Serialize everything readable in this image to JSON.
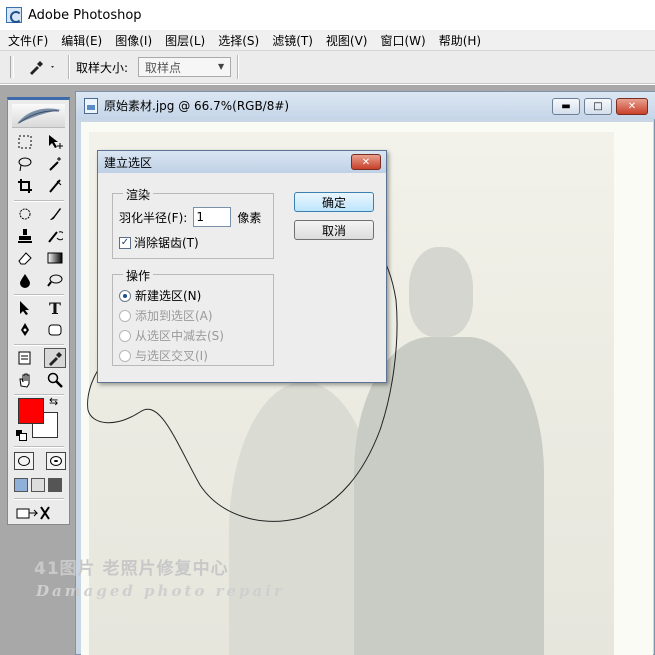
{
  "app": {
    "title": "Adobe Photoshop"
  },
  "menu": {
    "items": [
      "文件(F)",
      "编辑(E)",
      "图像(I)",
      "图层(L)",
      "选择(S)",
      "滤镜(T)",
      "视图(V)",
      "窗口(W)",
      "帮助(H)"
    ]
  },
  "options": {
    "tool_icon": "eyedropper-icon",
    "sample_size_label": "取样大小:",
    "sample_size_value": "取样点"
  },
  "document": {
    "title": "原始素材.jpg @ 66.7%(RGB/8#)",
    "minimize": "▬",
    "restore": "□",
    "close": "✕"
  },
  "watermark": {
    "line1": "41图片 老照片修复中心",
    "line2": "Damaged photo repair"
  },
  "dialog": {
    "title": "建立选区",
    "close": "✕",
    "render_group": "渲染",
    "feather_label": "羽化半径(F):",
    "feather_value": "1",
    "feather_unit": "像素",
    "antialias_label": "消除锯齿(T)",
    "antialias_checked": true,
    "operation_group": "操作",
    "operations": [
      {
        "label": "新建选区(N)",
        "checked": true,
        "enabled": true
      },
      {
        "label": "添加到选区(A)",
        "checked": false,
        "enabled": false
      },
      {
        "label": "从选区中减去(S)",
        "checked": false,
        "enabled": false
      },
      {
        "label": "与选区交叉(I)",
        "checked": false,
        "enabled": false
      }
    ],
    "ok": "确定",
    "cancel": "取消"
  },
  "colors": {
    "foreground": "#ff0000",
    "background": "#ffffff"
  }
}
